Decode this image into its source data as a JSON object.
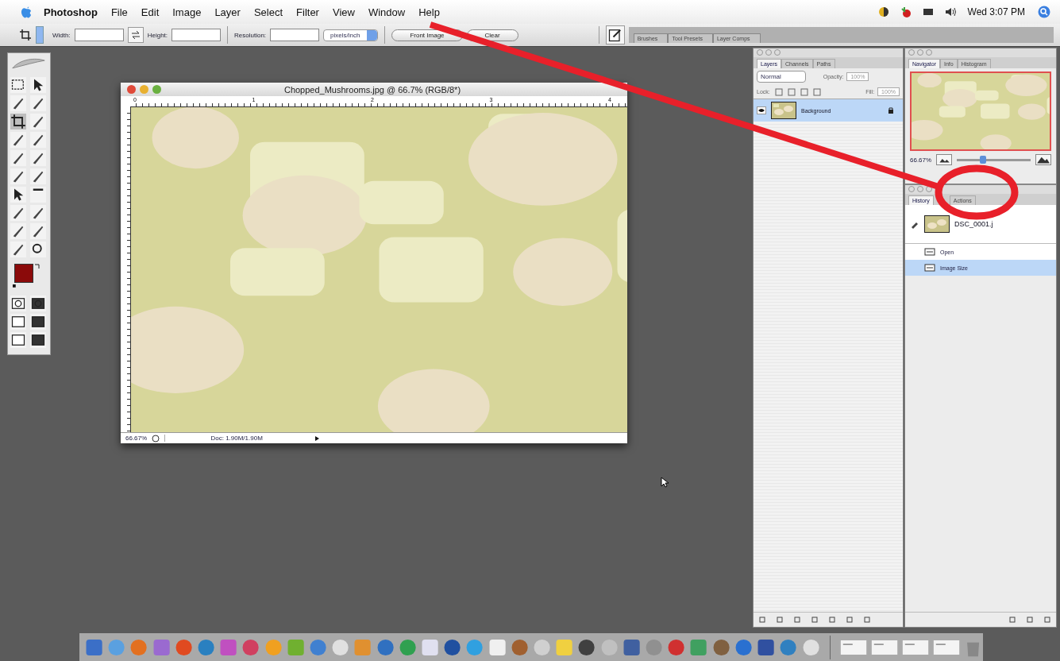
{
  "menu_bar": {
    "app": "Photoshop",
    "items": [
      "File",
      "Edit",
      "Image",
      "Layer",
      "Select",
      "Filter",
      "View",
      "Window",
      "Help"
    ],
    "clock": "Wed 3:07 PM"
  },
  "options_bar": {
    "width_label": "Width:",
    "height_label": "Height:",
    "resolution_label": "Resolution:",
    "units": "pixels/inch",
    "buttons": [
      "Front Image",
      "Clear"
    ],
    "palette_tabs": [
      "Brushes",
      "Tool Presets",
      "Layer Comps"
    ]
  },
  "document": {
    "title": "Chopped_Mushrooms.jpg @ 66.7% (RGB/8*)",
    "ruler_labels": [
      "0",
      "1",
      "2",
      "3",
      "4"
    ],
    "zoom": "66.67%",
    "status": "Doc: 1.90M/1.90M"
  },
  "layers_panel": {
    "tabs": [
      {
        "label": "Layers",
        "selected": true
      },
      {
        "label": "Channels",
        "selected": false
      },
      {
        "label": "Paths",
        "selected": false
      }
    ],
    "blend_mode": "Normal",
    "opacity_label": "Opacity:",
    "opacity": "100%",
    "lock_label": "Lock:",
    "fill_label": "Fill:",
    "fill": "100%",
    "layers": [
      {
        "name": "Background",
        "selected": true,
        "visible": true
      }
    ]
  },
  "navigator_panel": {
    "tabs": [
      {
        "label": "Navigator",
        "selected": true
      },
      {
        "label": "Info",
        "selected": false
      },
      {
        "label": "Histogram",
        "selected": false
      }
    ],
    "zoom": "66.67%",
    "zoom_slider": {
      "level": 0.35
    }
  },
  "history_panel": {
    "tabs": [
      {
        "label": "History",
        "selected": true
      },
      {
        "label": "Actions",
        "selected": false
      }
    ],
    "snapshot": "DSC_0001.j",
    "states": [
      {
        "name": "Open",
        "selected": false
      },
      {
        "name": "Image Size",
        "selected": true
      }
    ]
  }
}
